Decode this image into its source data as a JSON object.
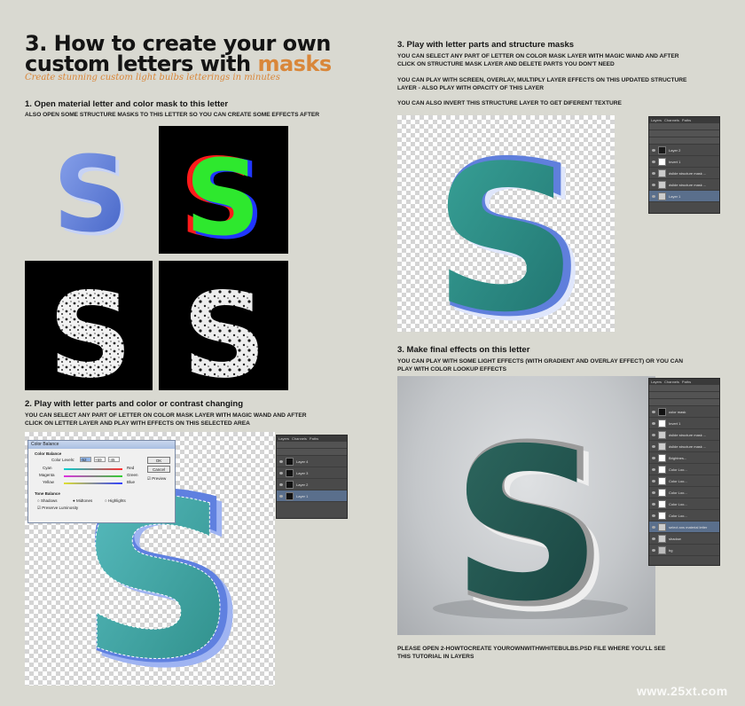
{
  "header": {
    "title_line1": "3. How to create your own",
    "title_line2_prefix": "custom letters with ",
    "title_line2_accent": "masks",
    "tagline": "Create stunning custom light bulbs letterings in minutes"
  },
  "step1": {
    "heading": "1. Open material letter and color mask to this letter",
    "text": "ALSO OPEN SOME STRUCTURE MASKS TO THIS LETTER SO YOU CAN CREATE SOME EFFECTS AFTER"
  },
  "step2": {
    "heading": "2. Play with letter parts and color or contrast changing",
    "text_line1": "YOU CAN SELECT ANY PART OF LETTER ON COLOR MASK LAYER WITH MAGIC WAND AND AFTER",
    "text_line2": "CLICK ON LETTER LAYER AND PLAY WITH EFFECTS ON THIS SELECTED AREA"
  },
  "step3a": {
    "heading": "3. Play with letter parts and structure masks",
    "p1_line1": "YOU CAN SELECT ANY PART OF LETTER ON COLOR MASK LAYER WITH MAGIC WAND AND AFTER",
    "p1_line2": "CLICK ON STRUCTURE MASK LAYER AND DELETE PARTS YOU DON'T NEED",
    "p2_line1": "YOU CAN PLAY WITH SCREEN, OVERLAY, MULTIPLY LAYER EFFECTS ON THIS UPDATED STRUCTURE",
    "p2_line2": "LAYER - ALSO PLAY WITH OPACITY OF THIS LAYER",
    "p3": "YOU CAN ALSO INVERT THIS STRUCTURE LAYER TO GET DIFERENT TEXTURE"
  },
  "step3b": {
    "heading": "3. Make final effects on this letter",
    "text_line1": "YOU CAN PLAY WITH SOME LIGHT EFFECTS (WITH GRADIENT AND OVERLAY EFFECT) OR YOU CAN",
    "text_line2": "PLAY WITH COLOR LOOKUP EFFECTS"
  },
  "footer": {
    "note_line1": "PLEASE OPEN 2-HOWTOCREATE YOUROWNWITHWHITEBULBS.PSD FILE WHERE YOU'LL SEE",
    "note_line2": "THIS TUTORIAL IN LAYERS",
    "watermark": "www.25xt.com"
  },
  "letter_glyph": "S",
  "colors": {
    "background": "#d9d9d1",
    "accent": "#d9873a",
    "letter_blue": "#5d7fd6",
    "letter_teal": "#2f8a86",
    "ps_panel": "#4a4a4a"
  },
  "color_balance_dialog": {
    "title": "Color Balance",
    "section_title": "Color Balance",
    "levels_label": "Color Levels:",
    "levels": [
      "-52",
      "+69",
      "-45"
    ],
    "left_labels": [
      "Cyan",
      "Magenta",
      "Yellow"
    ],
    "right_labels": [
      "Red",
      "Green",
      "Blue"
    ],
    "tone_title": "Tone Balance",
    "tones": [
      "Shadows",
      "Midtones",
      "Highlights"
    ],
    "preserve_label": "Preserve Luminosity",
    "ok_label": "OK",
    "cancel_label": "Cancel",
    "preview_label": "Preview"
  },
  "layers_panel_1": {
    "tabs": [
      "Layers",
      "Channels",
      "Paths"
    ],
    "layers": [
      "Layer 4",
      "Layer 3",
      "Layer 2",
      "Layer 1"
    ]
  },
  "layers_panel_2": {
    "tabs": [
      "Layers",
      "Channels",
      "Paths"
    ],
    "layers": [
      "Layer 2",
      "Invert 1",
      "dslide structure mask ...",
      "dslide structure mask ...",
      "Layer 1"
    ]
  },
  "layers_panel_3": {
    "tabs": [
      "Layers",
      "Channels",
      "Paths"
    ],
    "layers": [
      "color mask",
      "Invert 1",
      "dslide structure mask ...",
      "dslide structure mask ...",
      "Brightnes...",
      "Color Loo...",
      "Color Loo...",
      "Color Loo...",
      "Color Loo...",
      "Color Loo...",
      "select ans material letter",
      "shadow",
      "bg"
    ]
  }
}
